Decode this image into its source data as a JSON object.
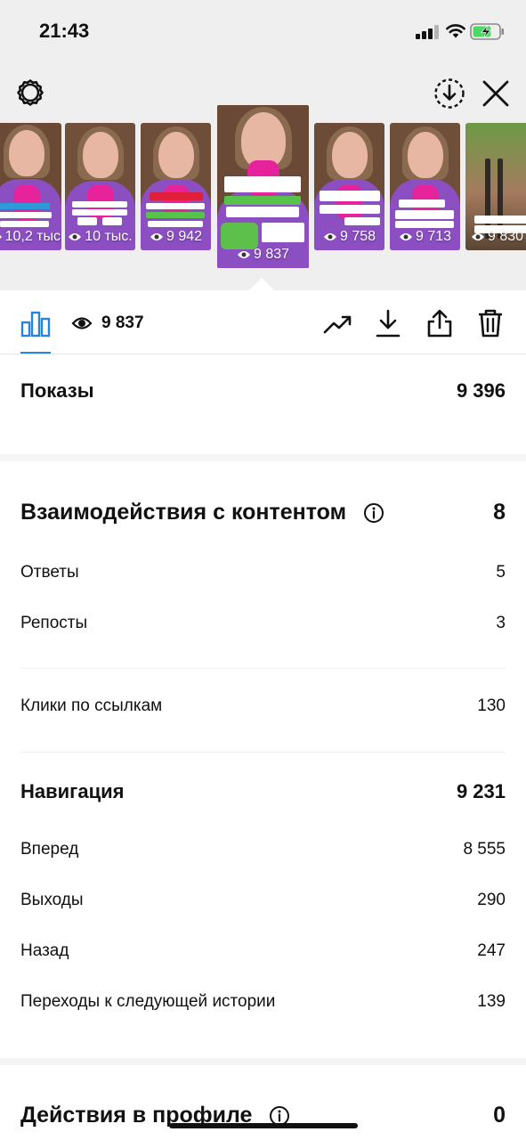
{
  "status_bar": {
    "time": "21:43"
  },
  "thumbnails": [
    {
      "views": "10,2 тыс."
    },
    {
      "views": "10 тыс."
    },
    {
      "views": "9 942"
    },
    {
      "views": "9 837",
      "selected": true
    },
    {
      "views": "9 758"
    },
    {
      "views": "9 713"
    },
    {
      "views": "9 830"
    }
  ],
  "toolbar": {
    "views_count": "9 837"
  },
  "impressions": {
    "label": "Показы",
    "value": "9 396"
  },
  "interactions": {
    "label": "Взаимодействия с контентом",
    "value": "8",
    "rows": [
      {
        "label": "Ответы",
        "value": "5"
      },
      {
        "label": "Репосты",
        "value": "3"
      }
    ],
    "link_clicks": {
      "label": "Клики по ссылкам",
      "value": "130"
    }
  },
  "navigation": {
    "label": "Навигация",
    "value": "9 231",
    "rows": [
      {
        "label": "Вперед",
        "value": "8 555"
      },
      {
        "label": "Выходы",
        "value": "290"
      },
      {
        "label": "Назад",
        "value": "247"
      },
      {
        "label": "Переходы к следующей истории",
        "value": "139"
      }
    ]
  },
  "profile_actions": {
    "label": "Действия в профиле",
    "value": "0"
  },
  "colors": {
    "accent": "#2b83d9",
    "jacket": "#8b4fc2",
    "scarf": "#e6239a"
  }
}
